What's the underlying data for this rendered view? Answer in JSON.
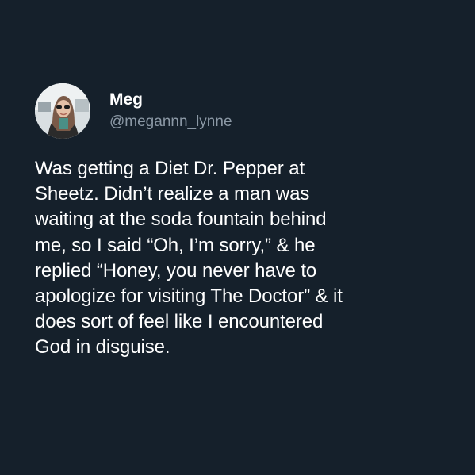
{
  "tweet": {
    "author": {
      "display_name": "Meg",
      "handle": "@megannn_lynne"
    },
    "text": "Was getting a Diet Dr. Pepper at\nSheetz. Didn’t realize a man was\nwaiting at the soda fountain behind\nme, so I said “Oh, I’m sorry,” & he\nreplied “Honey, you never have to\napologize for visiting The Doctor” & it\ndoes sort of feel like I encountered\nGod in disguise."
  },
  "colors": {
    "background": "#15202b",
    "text_primary": "#ffffff",
    "text_secondary": "#8b98a5"
  }
}
